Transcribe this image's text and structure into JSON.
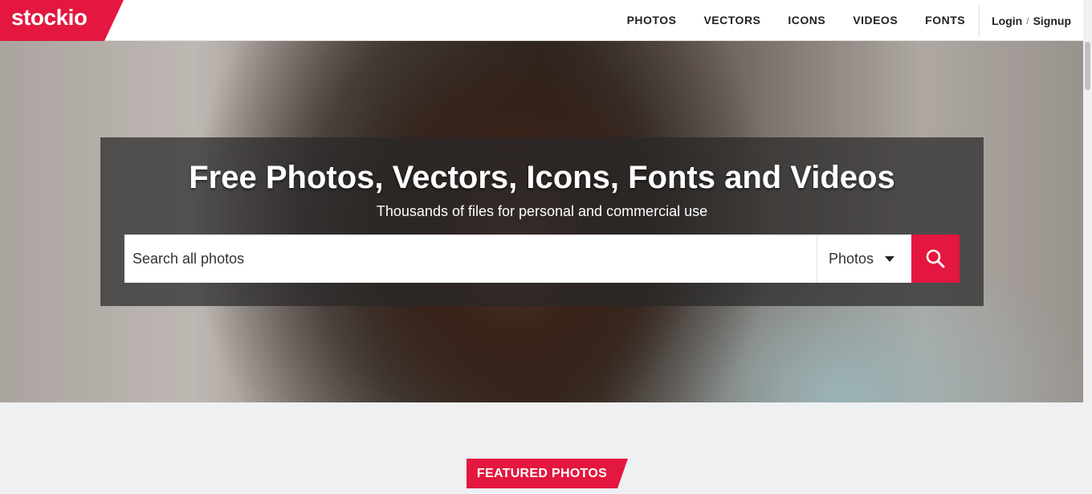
{
  "brand": {
    "logo_text": "stockio",
    "accent_color": "#e3173f"
  },
  "nav": {
    "items": [
      {
        "label": "PHOTOS"
      },
      {
        "label": "VECTORS"
      },
      {
        "label": "ICONS"
      },
      {
        "label": "VIDEOS"
      },
      {
        "label": "FONTS"
      }
    ],
    "login_label": "Login",
    "separator": "/",
    "signup_label": "Signup"
  },
  "hero": {
    "title": "Free Photos, Vectors, Icons, Fonts and Videos",
    "subtitle": "Thousands of files for personal and commercial use",
    "search": {
      "placeholder": "Search all photos",
      "value": "",
      "type_selected": "Photos",
      "search_icon": "search-icon",
      "dropdown_icon": "caret-down-icon"
    }
  },
  "featured": {
    "label": "FEATURED PHOTOS"
  }
}
